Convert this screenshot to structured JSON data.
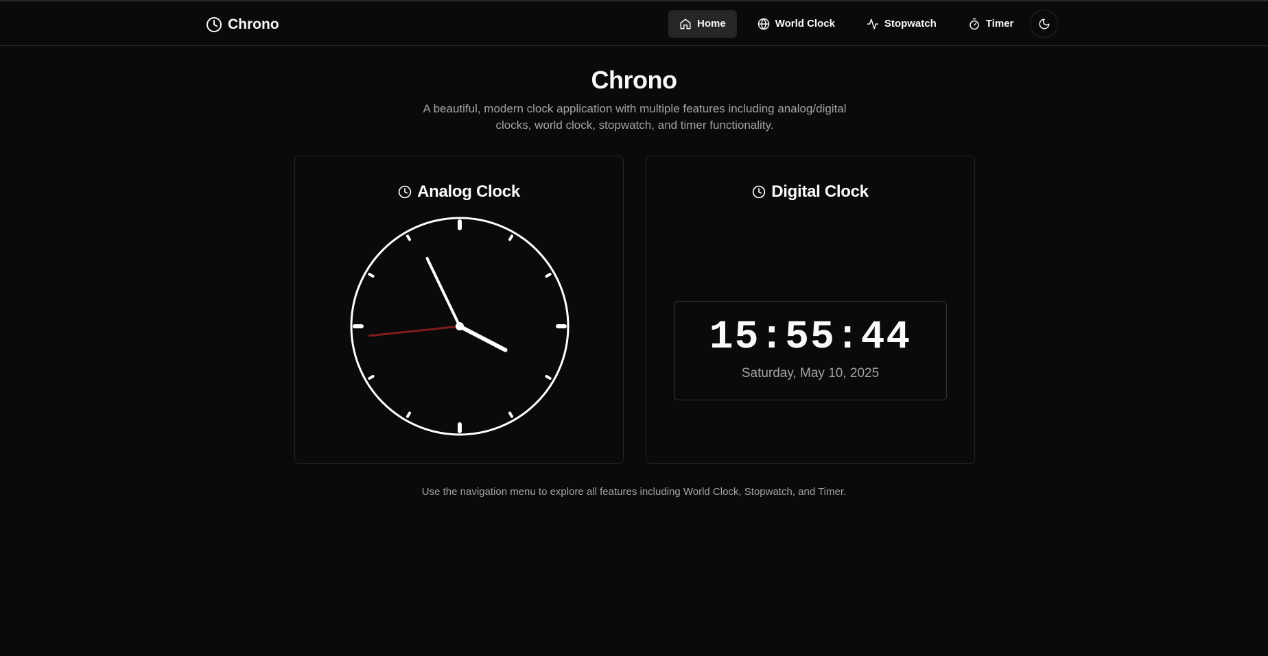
{
  "app": {
    "name": "Chrono"
  },
  "nav": {
    "items": [
      {
        "label": "Home",
        "icon": "home-icon",
        "active": true
      },
      {
        "label": "World Clock",
        "icon": "globe-icon",
        "active": false
      },
      {
        "label": "Stopwatch",
        "icon": "activity-icon",
        "active": false
      },
      {
        "label": "Timer",
        "icon": "timer-icon",
        "active": false
      }
    ],
    "theme_toggle_icon": "moon-icon"
  },
  "hero": {
    "title": "Chrono",
    "subtitle": "A beautiful, modern clock application with multiple features including analog/digital clocks, world clock, stopwatch, and timer functionality."
  },
  "analog": {
    "title": "Analog Clock",
    "icon": "clock-icon",
    "time": {
      "hours": 15,
      "minutes": 55,
      "seconds": 44
    },
    "colors": {
      "face": "#ffffff",
      "second_hand": "#7f1d1d"
    }
  },
  "digital": {
    "title": "Digital Clock",
    "icon": "clock-icon",
    "time": "15:55:44",
    "date": "Saturday, May 10, 2025"
  },
  "footer": {
    "note": "Use the navigation menu to explore all features including World Clock, Stopwatch, and Timer."
  },
  "colors": {
    "background": "#0a0a0a",
    "border": "#262626",
    "muted_text": "#a3a3a3",
    "active_nav": "#262626"
  }
}
